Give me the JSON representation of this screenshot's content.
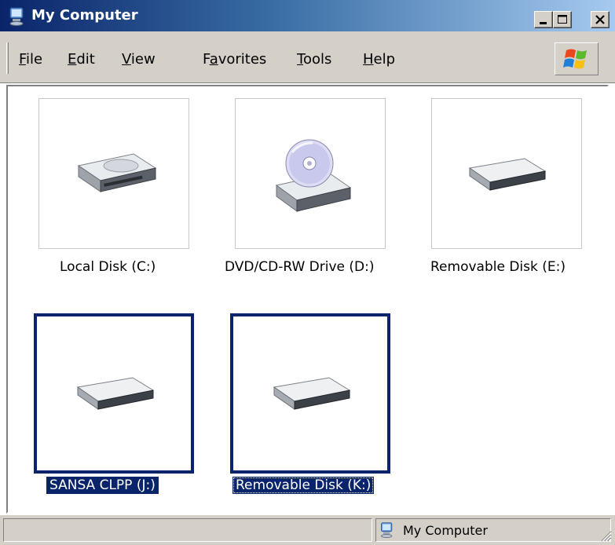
{
  "window": {
    "title": "My Computer",
    "accent": "#0a246a"
  },
  "titlebar": {
    "controls": [
      "minimize",
      "maximize",
      "close"
    ]
  },
  "menu": {
    "items": [
      {
        "label": "File",
        "accel": "F"
      },
      {
        "label": "Edit",
        "accel": "E"
      },
      {
        "label": "View",
        "accel": "V"
      },
      {
        "label": "Favorites",
        "accel": "a"
      },
      {
        "label": "Tools",
        "accel": "T"
      },
      {
        "label": "Help",
        "accel": "H"
      }
    ]
  },
  "drives": [
    {
      "label": "Local Disk (C:)",
      "icon": "hard-disk-icon",
      "selected": false
    },
    {
      "label": "DVD/CD-RW Drive (D:)",
      "icon": "dvd-drive-icon",
      "selected": false
    },
    {
      "label": "Removable Disk (E:)",
      "icon": "removable-disk-icon",
      "selected": false
    },
    {
      "label": "SANSA CLPP (J:)",
      "icon": "removable-disk-icon",
      "selected": true
    },
    {
      "label": "Removable Disk (K:)",
      "icon": "removable-disk-icon",
      "selected": true,
      "focused": true
    }
  ],
  "status": {
    "left": "",
    "location": "My Computer"
  }
}
